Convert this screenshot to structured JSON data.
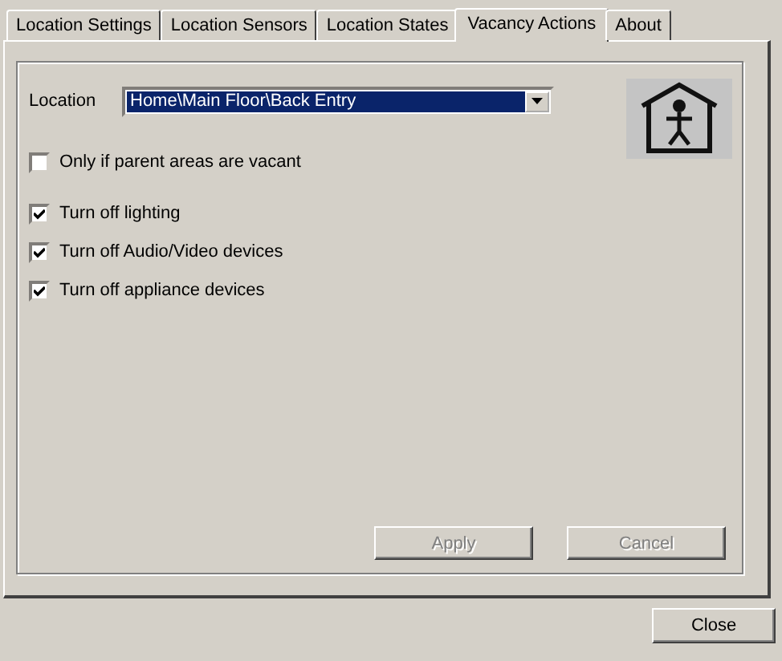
{
  "tabs": [
    {
      "label": "Location Settings",
      "selected": false
    },
    {
      "label": "Location Sensors",
      "selected": false
    },
    {
      "label": "Location States",
      "selected": false
    },
    {
      "label": "Vacancy Actions",
      "selected": true
    },
    {
      "label": "About",
      "selected": false
    }
  ],
  "location": {
    "label": "Location",
    "value": "Home\\Main Floor\\Back Entry"
  },
  "options": [
    {
      "label": "Only if parent areas are vacant",
      "checked": false
    },
    {
      "label": "Turn off lighting",
      "checked": true
    },
    {
      "label": "Turn off Audio/Video devices",
      "checked": true
    },
    {
      "label": "Turn off appliance devices",
      "checked": true
    }
  ],
  "panel_buttons": [
    {
      "label": "Apply",
      "disabled": true
    },
    {
      "label": "Cancel",
      "disabled": true
    }
  ],
  "close_button": {
    "label": "Close",
    "disabled": false
  }
}
